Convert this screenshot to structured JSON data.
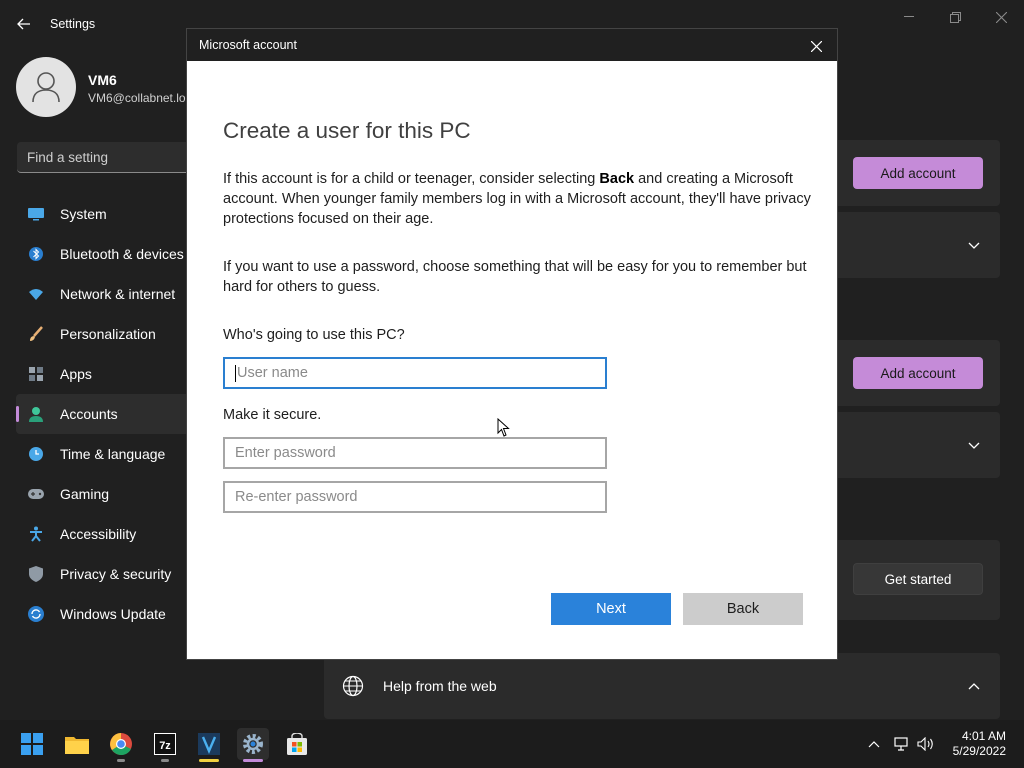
{
  "window": {
    "title": "Settings"
  },
  "profile": {
    "name": "VM6",
    "email": "VM6@collabnet.lo"
  },
  "search": {
    "placeholder": "Find a setting"
  },
  "nav": {
    "items": [
      {
        "label": "System",
        "icon": "system-icon"
      },
      {
        "label": "Bluetooth & devices",
        "icon": "bluetooth-icon"
      },
      {
        "label": "Network & internet",
        "icon": "wifi-icon"
      },
      {
        "label": "Personalization",
        "icon": "brush-icon"
      },
      {
        "label": "Apps",
        "icon": "apps-icon"
      },
      {
        "label": "Accounts",
        "icon": "accounts-icon",
        "active": true
      },
      {
        "label": "Time & language",
        "icon": "clock-icon"
      },
      {
        "label": "Gaming",
        "icon": "gamepad-icon"
      },
      {
        "label": "Accessibility",
        "icon": "accessibility-icon"
      },
      {
        "label": "Privacy & security",
        "icon": "shield-icon"
      },
      {
        "label": "Windows Update",
        "icon": "update-icon"
      }
    ]
  },
  "background_panel": {
    "add_account_1": "Add account",
    "add_account_2": "Add account",
    "get_started": "Get started",
    "help_from_web": "Help from the web"
  },
  "dialog": {
    "title": "Microsoft account",
    "heading": "Create a user for this PC",
    "para1_before": "If this account is for a child or teenager, consider selecting ",
    "para1_bold": "Back",
    "para1_after": " and creating a Microsoft account. When younger family members log in with a Microsoft account, they'll have privacy protections focused on their age.",
    "para2": "If you want to use a password, choose something that will be easy for you to remember but hard for others to guess.",
    "who_label": "Who's going to use this PC?",
    "username_placeholder": "User name",
    "secure_label": "Make it secure.",
    "password_placeholder": "Enter password",
    "reenter_placeholder": "Re-enter password",
    "next_label": "Next",
    "back_label": "Back"
  },
  "taskbar": {
    "apps": [
      "start-icon",
      "file-explorer-icon",
      "chrome-icon",
      "7zip-icon",
      "v-app-icon",
      "settings-icon",
      "store-icon"
    ],
    "time": "4:01 AM",
    "date": "5/29/2022"
  },
  "colors": {
    "accent_purple": "#c58bd8",
    "dialog_primary": "#2a82da",
    "dark_bg": "#202020"
  }
}
